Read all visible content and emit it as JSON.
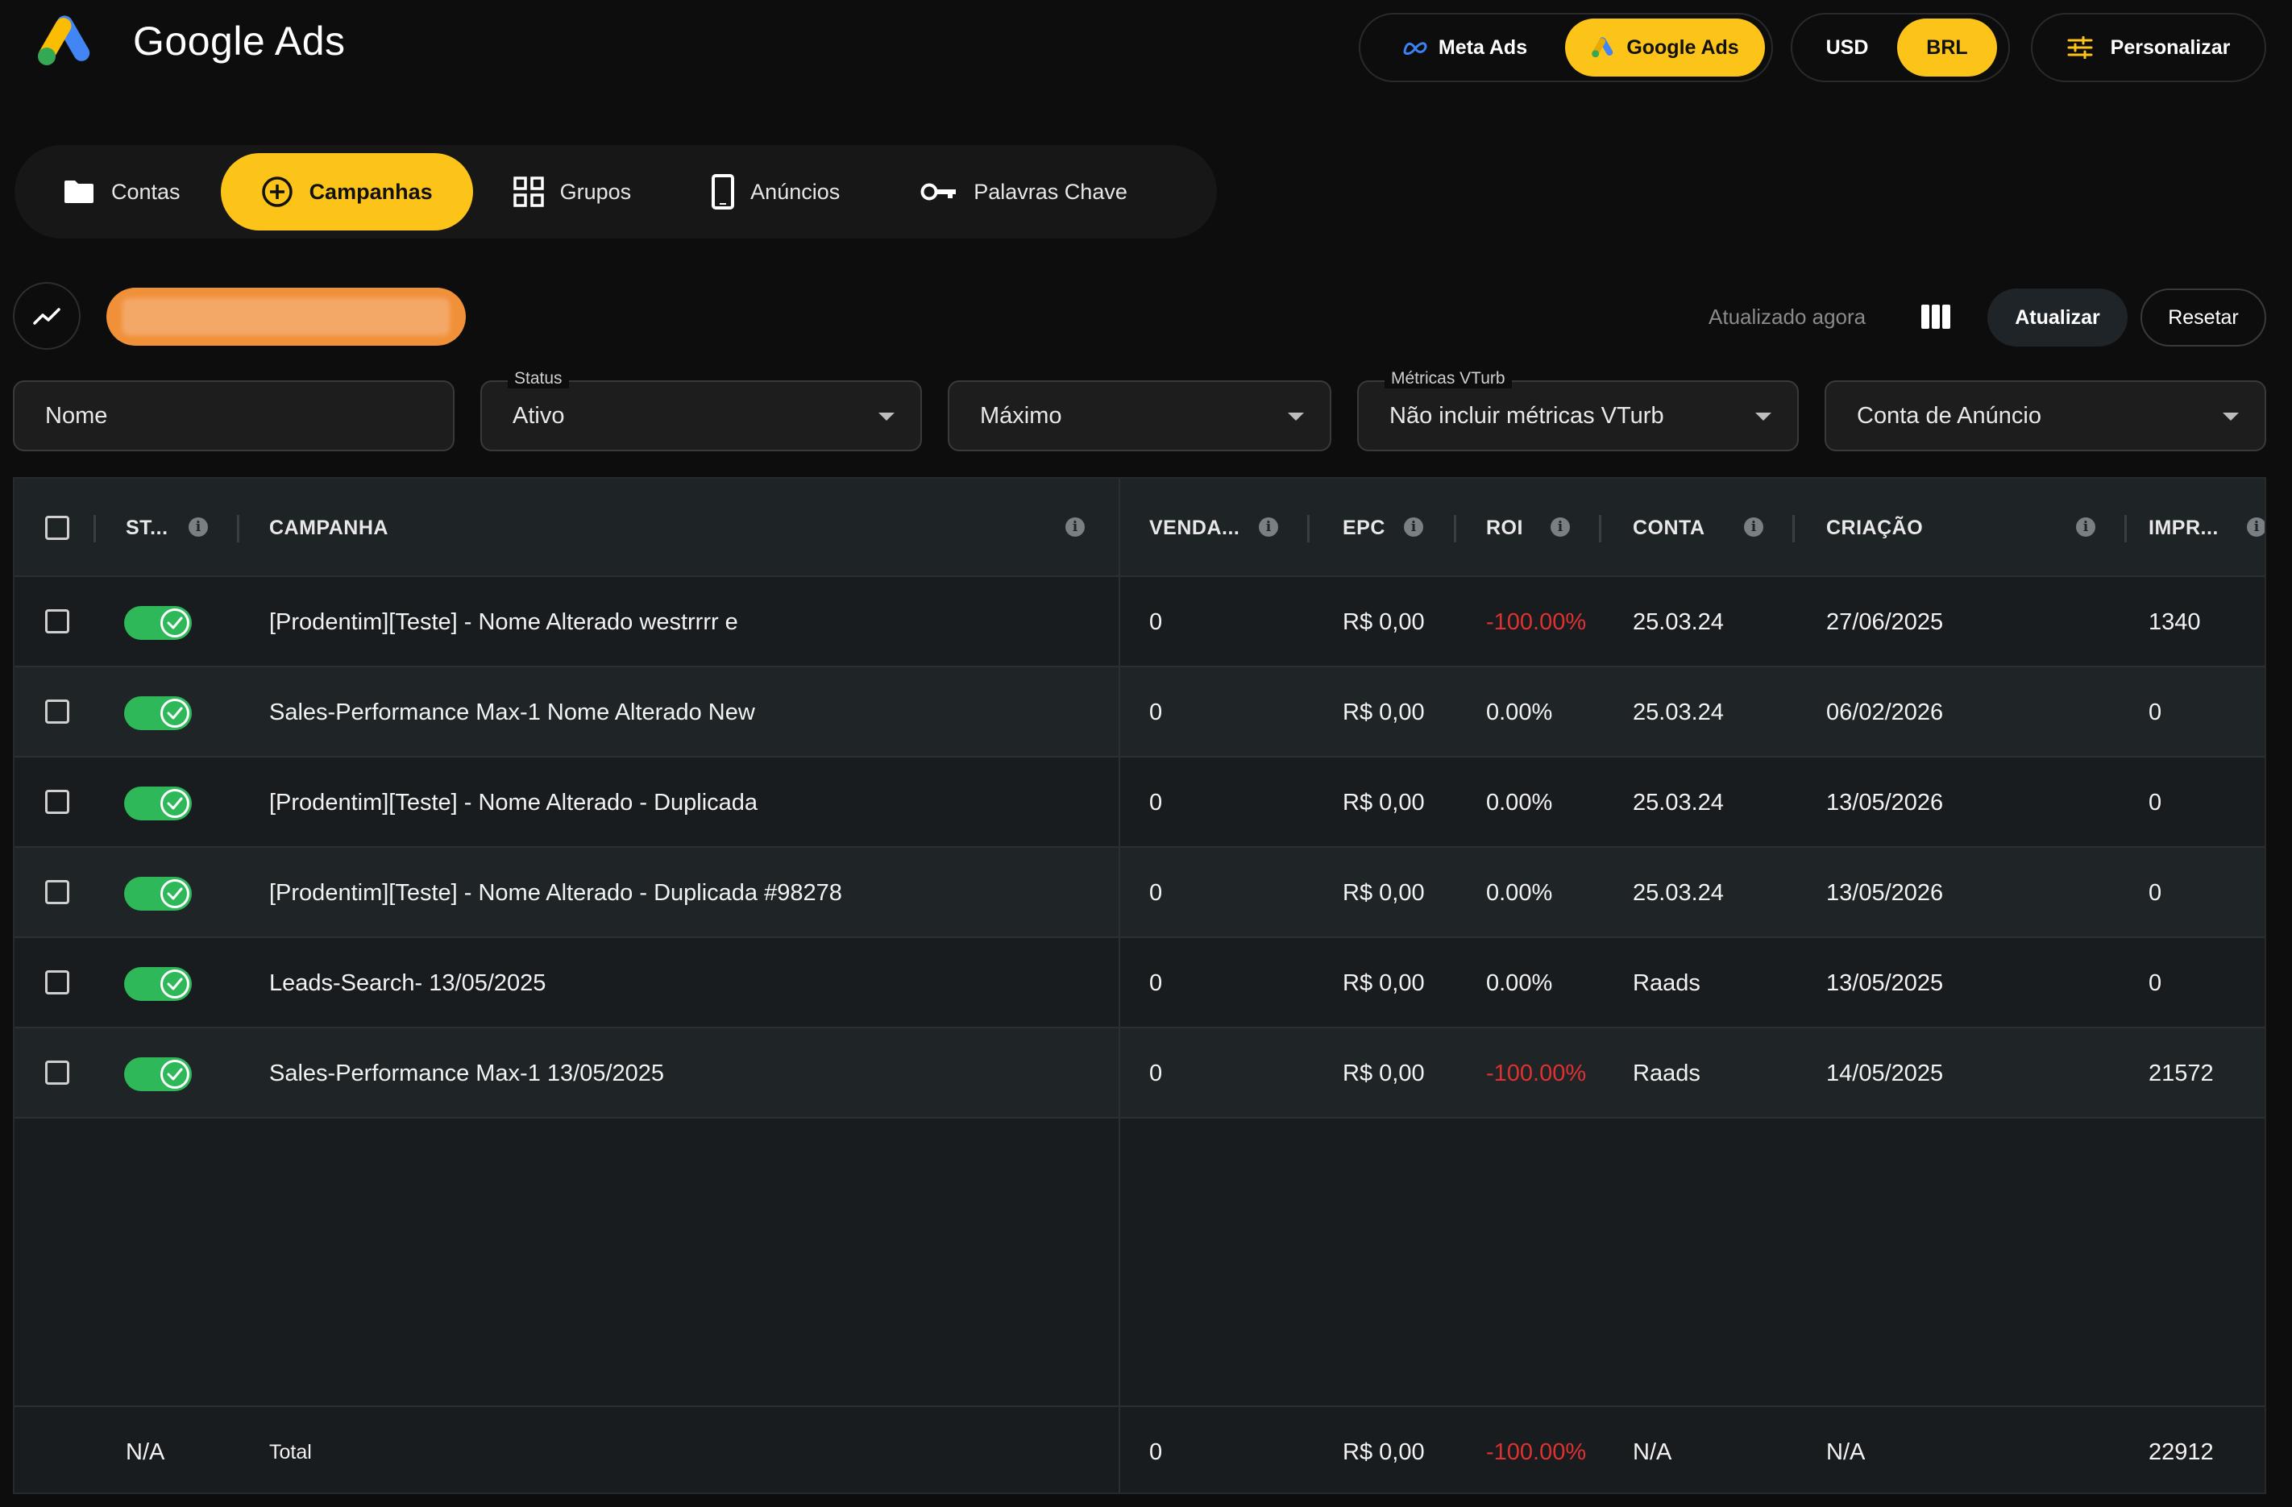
{
  "header": {
    "title": "Google Ads",
    "platforms": [
      "Meta Ads",
      "Google Ads"
    ],
    "active_platform": "Google Ads",
    "currencies": [
      "USD",
      "BRL"
    ],
    "active_currency": "BRL",
    "personalizar_label": "Personalizar"
  },
  "nav": {
    "tabs": [
      {
        "label": "Contas",
        "icon": "folder-icon"
      },
      {
        "label": "Campanhas",
        "icon": "plus-circle-icon"
      },
      {
        "label": "Grupos",
        "icon": "grid-icon"
      },
      {
        "label": "Anúncios",
        "icon": "phone-icon"
      },
      {
        "label": "Palavras Chave",
        "icon": "key-icon"
      }
    ],
    "active": "Campanhas"
  },
  "toolbar": {
    "updated_text": "Atualizado agora",
    "refresh_label": "Atualizar",
    "reset_label": "Resetar"
  },
  "filters": {
    "name_placeholder": "Nome",
    "status_label": "Status",
    "status_value": "Ativo",
    "period_value": "Máximo",
    "vturb_label": "Métricas VTurb",
    "vturb_value": "Não incluir métricas VTurb",
    "account_placeholder": "Conta de Anúncio"
  },
  "table": {
    "columns": [
      "ST...",
      "CAMPANHA",
      "VENDA...",
      "EPC",
      "ROI",
      "CONTA",
      "CRIAÇÃO",
      "IMPR..."
    ],
    "rows": [
      {
        "campaign": "[Prodentim][Teste] - Nome Alterado westrrrr e",
        "sales": "0",
        "epc": "R$ 0,00",
        "roi": "-100.00%",
        "roi_negative": true,
        "account": "25.03.24",
        "created": "27/06/2025",
        "impressions": "1340"
      },
      {
        "campaign": "Sales-Performance Max-1 Nome Alterado New",
        "sales": "0",
        "epc": "R$ 0,00",
        "roi": "0.00%",
        "roi_negative": false,
        "account": "25.03.24",
        "created": "06/02/2026",
        "impressions": "0"
      },
      {
        "campaign": "[Prodentim][Teste] - Nome Alterado - Duplicada",
        "sales": "0",
        "epc": "R$ 0,00",
        "roi": "0.00%",
        "roi_negative": false,
        "account": "25.03.24",
        "created": "13/05/2026",
        "impressions": "0"
      },
      {
        "campaign": "[Prodentim][Teste] - Nome Alterado - Duplicada #98278",
        "sales": "0",
        "epc": "R$ 0,00",
        "roi": "0.00%",
        "roi_negative": false,
        "account": "25.03.24",
        "created": "13/05/2026",
        "impressions": "0"
      },
      {
        "campaign": "Leads-Search- 13/05/2025",
        "sales": "0",
        "epc": "R$ 0,00",
        "roi": "0.00%",
        "roi_negative": false,
        "account": "Raads",
        "created": "13/05/2025",
        "impressions": "0"
      },
      {
        "campaign": "Sales-Performance Max-1 13/05/2025",
        "sales": "0",
        "epc": "R$ 0,00",
        "roi": "-100.00%",
        "roi_negative": true,
        "account": "Raads",
        "created": "14/05/2025",
        "impressions": "21572"
      }
    ],
    "footer": {
      "status": "N/A",
      "label": "Total",
      "sales": "0",
      "epc": "R$ 0,00",
      "roi": "-100.00%",
      "account": "N/A",
      "created": "N/A",
      "impressions": "22912"
    }
  },
  "colors": {
    "accent": "#fcc419",
    "toggle_on": "#2fb85a",
    "negative": "#e03131",
    "chip": "#f0913a"
  }
}
